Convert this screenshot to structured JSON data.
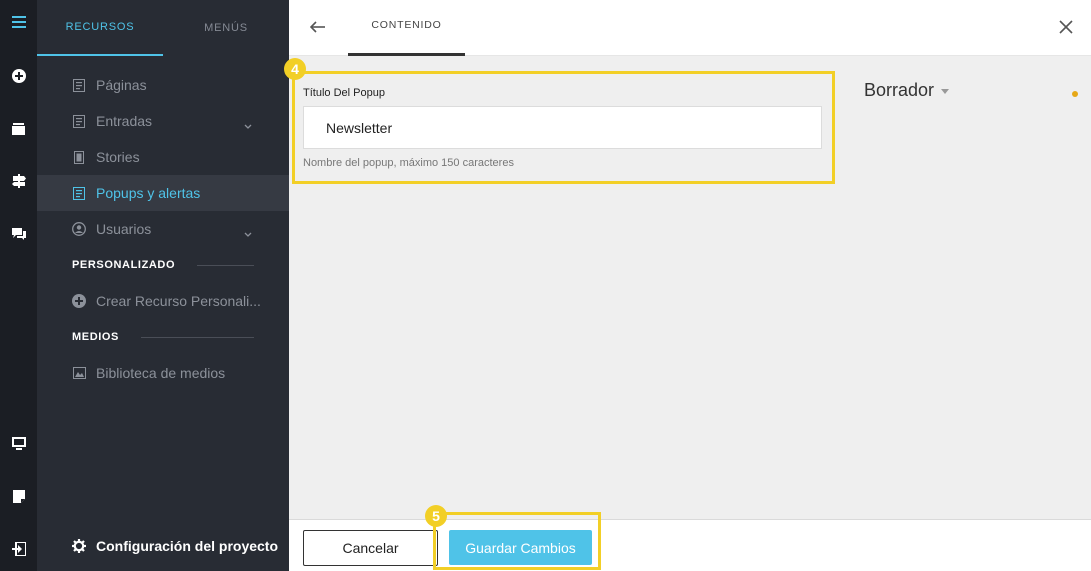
{
  "rail": {
    "icons": [
      "hamburger-menu-icon",
      "add-circle-icon",
      "archive-icon",
      "signpost-icon",
      "chat-icon",
      "monitor-icon",
      "note-icon",
      "logout-icon"
    ]
  },
  "sidebar": {
    "tabs": [
      {
        "label": "RECURSOS",
        "active": true
      },
      {
        "label": "MENÚS",
        "active": false
      }
    ],
    "items": [
      {
        "label": "Páginas",
        "icon": "page-icon"
      },
      {
        "label": "Entradas",
        "icon": "page-icon",
        "expandable": true
      },
      {
        "label": "Stories",
        "icon": "story-icon"
      },
      {
        "label": "Popups y alertas",
        "icon": "page-icon",
        "active": true
      },
      {
        "label": "Usuarios",
        "icon": "user-icon",
        "expandable": true
      }
    ],
    "sections": [
      {
        "title": "PERSONALIZADO",
        "items": [
          {
            "label": "Crear Recurso Personali...",
            "icon": "add-circle-icon"
          }
        ]
      },
      {
        "title": "MEDIOS",
        "items": [
          {
            "label": "Biblioteca de medios",
            "icon": "image-icon"
          }
        ]
      }
    ],
    "settings_label": "Configuración del proyecto"
  },
  "topbar": {
    "tab_label": "CONTENIDO"
  },
  "form": {
    "title_label": "Título Del Popup",
    "title_value": "Newsletter",
    "title_help": "Nombre del popup, máximo 150 caracteres"
  },
  "status": {
    "label": "Borrador",
    "dot_color": "#e6a817"
  },
  "footer": {
    "cancel_label": "Cancelar",
    "save_label": "Guardar Cambios"
  },
  "annotations": {
    "step_field": "4",
    "step_save": "5",
    "highlight_color": "#f2cf26"
  },
  "colors": {
    "accent": "#4fc3e8",
    "sidebar_bg": "#282c34",
    "rail_bg": "#1b1e24"
  }
}
